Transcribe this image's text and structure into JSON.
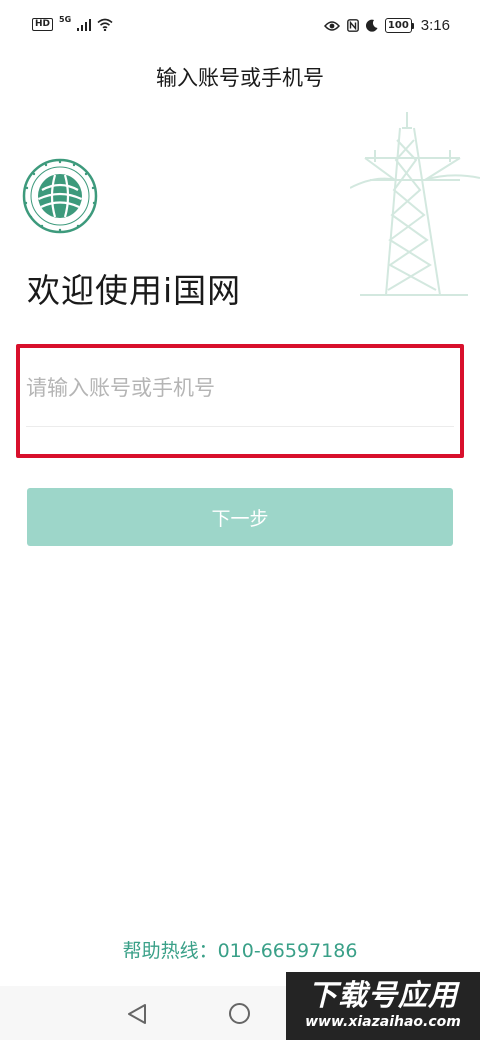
{
  "status_bar": {
    "hd_label": "HD",
    "network_label": "5G",
    "battery_level": "100",
    "time": "3:16",
    "icons": [
      "hd-badge",
      "signal-icon",
      "wifi-icon",
      "eye-icon",
      "nfc-icon",
      "moon-icon",
      "battery-icon"
    ]
  },
  "header": {
    "title": "输入账号或手机号"
  },
  "welcome": {
    "text": "欢迎使用i国网"
  },
  "login": {
    "account_placeholder": "请输入账号或手机号",
    "account_value": "",
    "next_label": "下一步"
  },
  "help": {
    "text": "帮助热线：010-66597186"
  },
  "nav_bar": {
    "icons": [
      "back-icon",
      "home-icon"
    ]
  },
  "watermark": {
    "title": "下载号应用",
    "url": "www.xiazaihao.com"
  },
  "colors": {
    "accent": "#3aa088",
    "button_disabled": "#9dd6c9",
    "highlight": "#d8102c",
    "placeholder": "#b5b5b5",
    "logo": "#3d9a7c"
  }
}
